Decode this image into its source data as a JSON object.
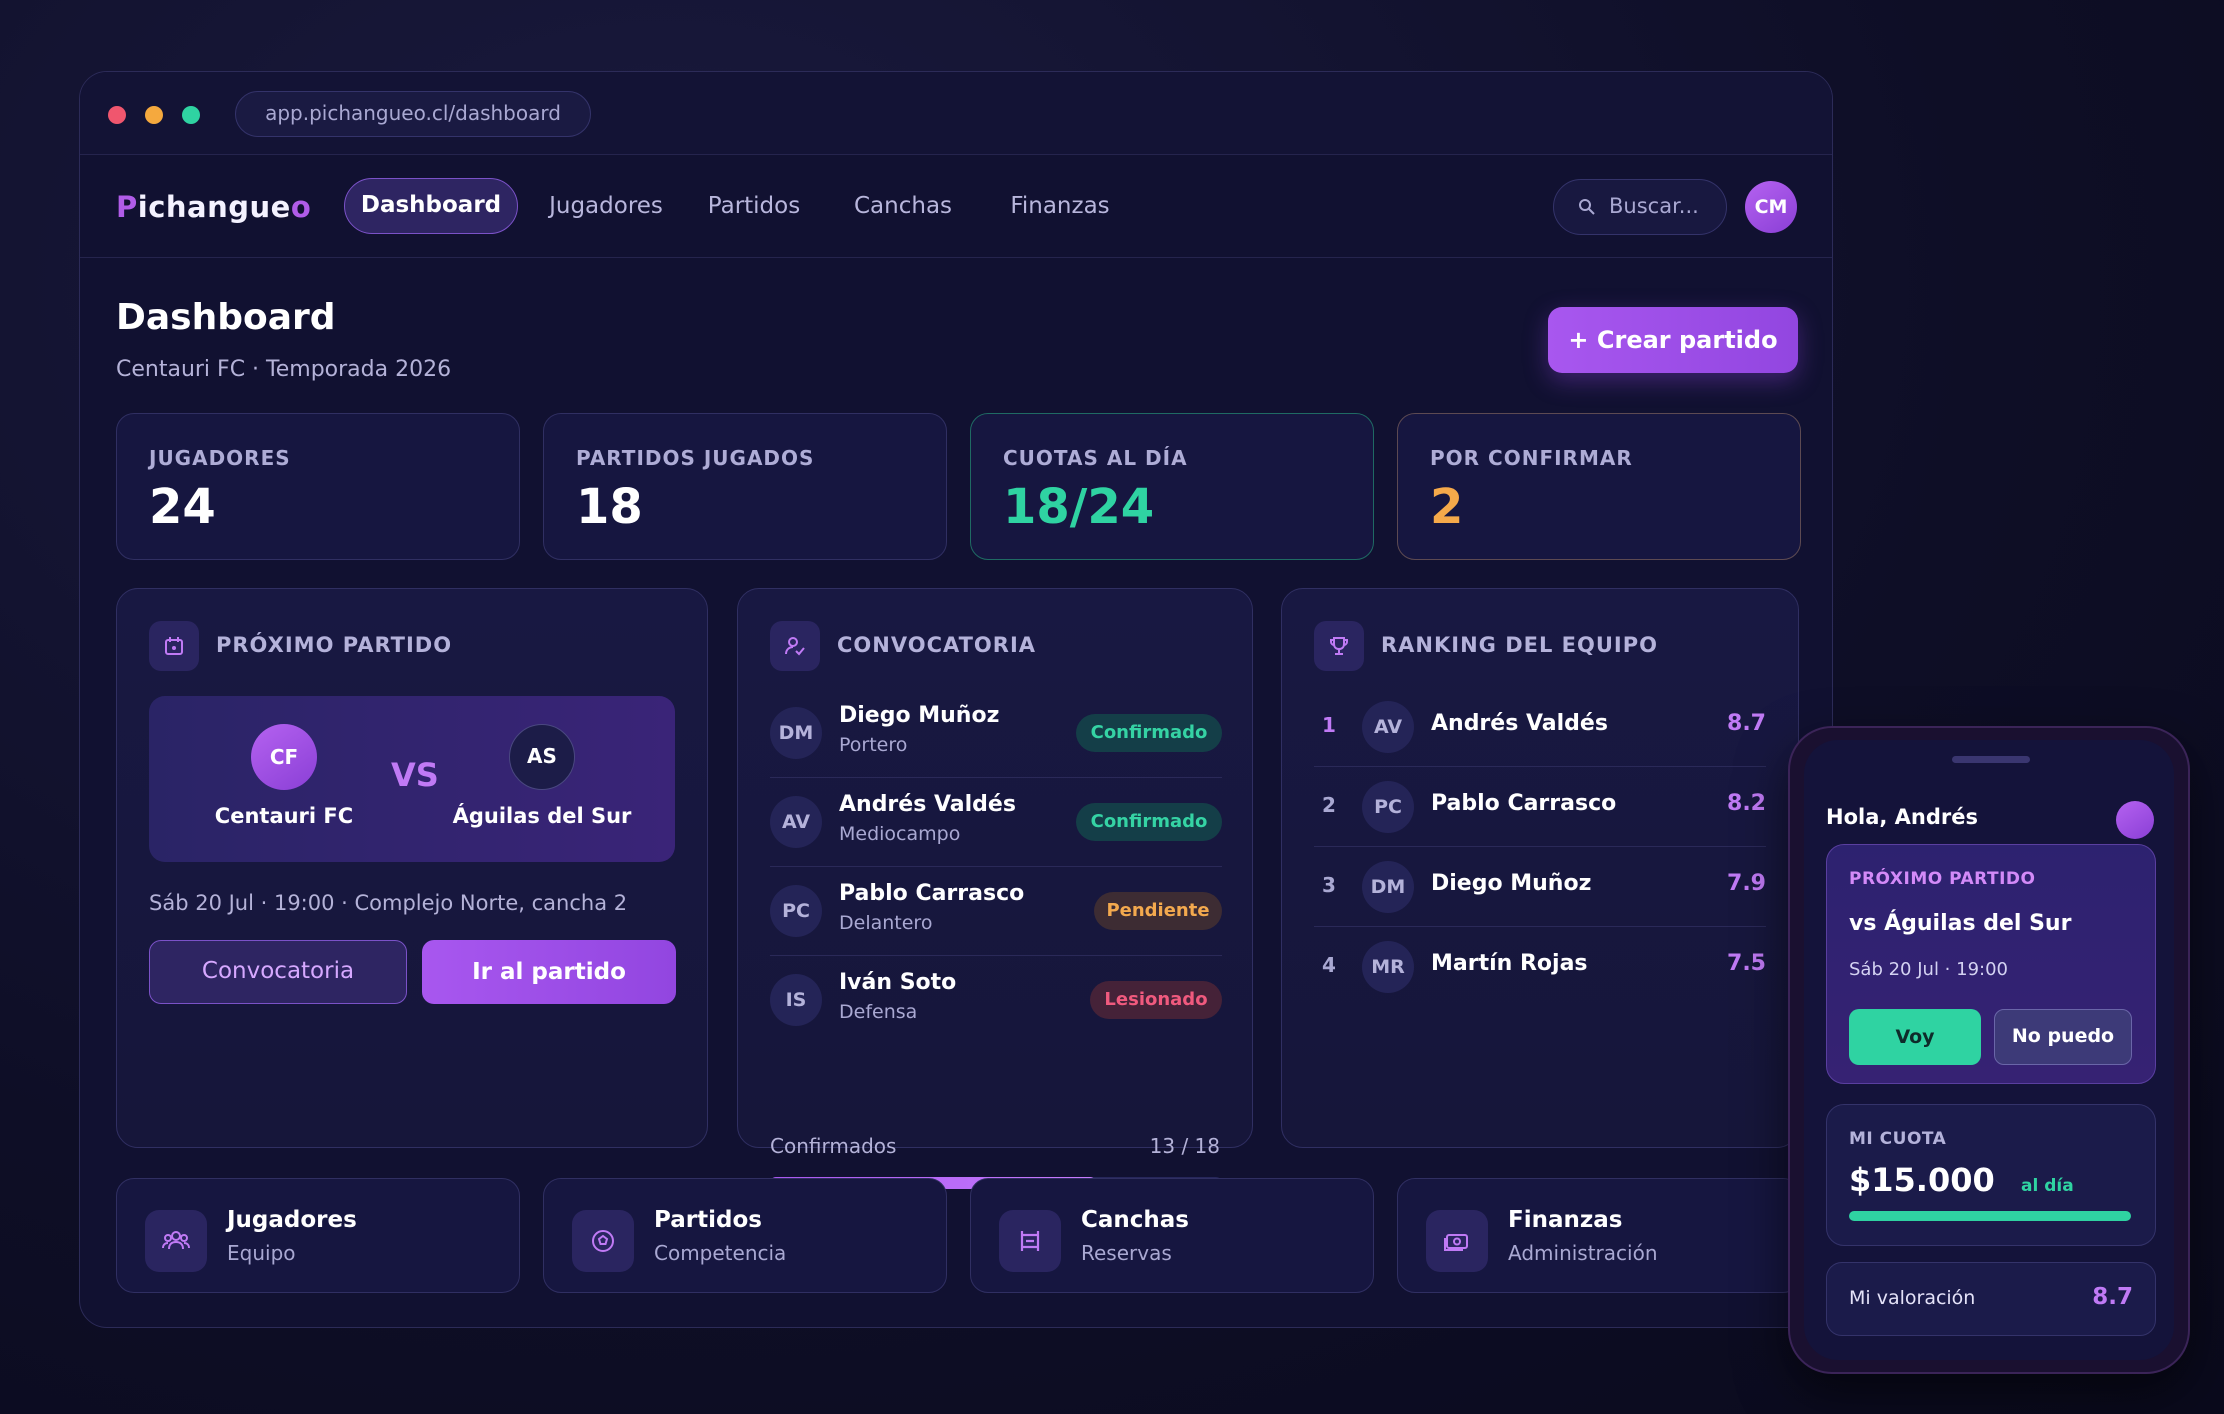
{
  "browser": {
    "url": "app.pichangueo.cl/dashboard"
  },
  "brand": {
    "name_first": "P",
    "name_rest": "ichangue",
    "name_last": "o"
  },
  "nav": {
    "items": [
      {
        "label": "Dashboard",
        "active": true
      },
      {
        "label": "Jugadores",
        "active": false
      },
      {
        "label": "Partidos",
        "active": false
      },
      {
        "label": "Canchas",
        "active": false
      },
      {
        "label": "Finanzas",
        "active": false
      }
    ],
    "search_placeholder": "Buscar...",
    "avatar_initials": "CM"
  },
  "header": {
    "title": "Dashboard",
    "subtitle": "Centauri FC · Temporada 2026",
    "create_button": "+ Crear partido"
  },
  "stats": [
    {
      "label": "JUGADORES",
      "value": "24",
      "color": "#ffffff"
    },
    {
      "label": "PARTIDOS JUGADOS",
      "value": "18",
      "color": "#ffffff"
    },
    {
      "label": "CUOTAS AL DÍA",
      "value": "18/24",
      "color": "#2fd3a2"
    },
    {
      "label": "POR CONFIRMAR",
      "value": "2",
      "color": "#f5a94a"
    }
  ],
  "next_match": {
    "title": "PRÓXIMO PARTIDO",
    "home": {
      "initials": "CF",
      "name": "Centauri FC"
    },
    "vs": "VS",
    "away": {
      "initials": "AS",
      "name": "Águilas del Sur"
    },
    "info": "Sáb 20 Jul · 19:00 · Complejo Norte, cancha 2",
    "btn_convocatoria": "Convocatoria",
    "btn_go": "Ir al partido"
  },
  "convocatoria": {
    "title": "CONVOCATORIA",
    "players": [
      {
        "initials": "DM",
        "name": "Diego Muñoz",
        "role": "Portero",
        "status": "Confirmado",
        "kind": "ok"
      },
      {
        "initials": "AV",
        "name": "Andrés Valdés",
        "role": "Mediocampo",
        "status": "Confirmado",
        "kind": "ok"
      },
      {
        "initials": "PC",
        "name": "Pablo Carrasco",
        "role": "Delantero",
        "status": "Pendiente",
        "kind": "pend"
      },
      {
        "initials": "IS",
        "name": "Iván Soto",
        "role": "Defensa",
        "status": "Lesionado",
        "kind": "inj"
      }
    ],
    "confirmed_label": "Confirmados",
    "confirmed_count": "13 / 18",
    "confirmed_fraction": 0.722
  },
  "ranking": {
    "title": "RANKING DEL EQUIPO",
    "rows": [
      {
        "pos": "1",
        "initials": "AV",
        "name": "Andrés Valdés",
        "score": "8.7",
        "pos_color": "#c07af5"
      },
      {
        "pos": "2",
        "initials": "PC",
        "name": "Pablo Carrasco",
        "score": "8.2",
        "pos_color": "#a9a8d2"
      },
      {
        "pos": "3",
        "initials": "DM",
        "name": "Diego Muñoz",
        "score": "7.9",
        "pos_color": "#a9a8d2"
      },
      {
        "pos": "4",
        "initials": "MR",
        "name": "Martín Rojas",
        "score": "7.5",
        "pos_color": "#a9a8d2"
      }
    ]
  },
  "modules": [
    {
      "title": "Jugadores",
      "subtitle": "Equipo",
      "icon": "users-icon"
    },
    {
      "title": "Partidos",
      "subtitle": "Competencia",
      "icon": "ball-icon"
    },
    {
      "title": "Canchas",
      "subtitle": "Reservas",
      "icon": "field-icon"
    },
    {
      "title": "Finanzas",
      "subtitle": "Administración",
      "icon": "money-icon"
    }
  ],
  "phone": {
    "greeting": "Hola, Andrés",
    "match_label": "PRÓXIMO PARTIDO",
    "match_vs": "vs Águilas del Sur",
    "match_date": "Sáb 20 Jul · 19:00",
    "btn_yes": "Voy",
    "btn_no": "No puedo",
    "fee_label": "MI CUOTA",
    "fee_amount": "$15.000",
    "fee_status": "al día",
    "rating_label": "Mi valoración",
    "rating_value": "8.7"
  }
}
